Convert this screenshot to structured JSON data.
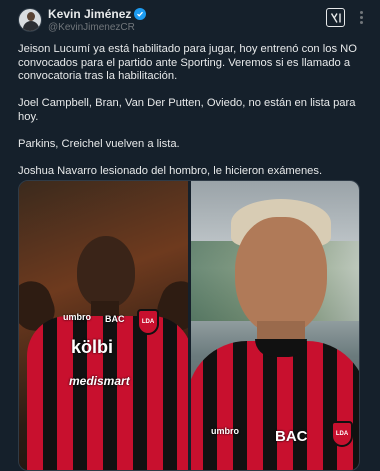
{
  "author": {
    "name": "Kevin Jiménez",
    "handle": "@KevinJimenezCR",
    "verified": true,
    "avatar_icon": "person-avatar-icon"
  },
  "actions": {
    "grok_icon": "xai-grok-icon",
    "more_icon": "more-options-icon"
  },
  "tweet": {
    "paragraphs": [
      "Jeison Lucumí ya está habilitado para jugar, hoy entrenó con los NO convocados para el partido ante Sporting. Veremos si es llamado a convocatoria tras la habilitación.",
      "Joel Campbell, Bran, Van Der Putten, Oviedo, no están en lista para hoy.",
      "Parkins, Creichel vuelven a lista.",
      "Joshua Navarro lesionado del hombro, le hicieron exámenes."
    ]
  },
  "media": {
    "left_photo": {
      "sponsor_main": "kölbi",
      "sponsor_secondary": "medismart",
      "brand": "umbro",
      "bank": "BAC",
      "crest": "LDA"
    },
    "right_photo": {
      "brand": "umbro",
      "bank": "BAC",
      "crest": "LDA"
    }
  },
  "colors": {
    "background": "#15202b",
    "text": "#e7e9ea",
    "muted": "#71767b",
    "verified": "#1d9bf0",
    "jersey_red": "#c8102e",
    "jersey_black": "#111111"
  }
}
